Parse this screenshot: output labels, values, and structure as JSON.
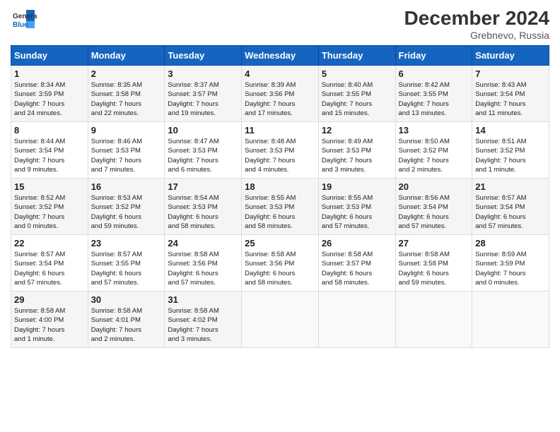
{
  "header": {
    "logo_line1": "General",
    "logo_line2": "Blue",
    "month": "December 2024",
    "location": "Grebnevo, Russia"
  },
  "days_of_week": [
    "Sunday",
    "Monday",
    "Tuesday",
    "Wednesday",
    "Thursday",
    "Friday",
    "Saturday"
  ],
  "weeks": [
    [
      {
        "day": "1",
        "info": "Sunrise: 8:34 AM\nSunset: 3:59 PM\nDaylight: 7 hours\nand 24 minutes."
      },
      {
        "day": "2",
        "info": "Sunrise: 8:35 AM\nSunset: 3:58 PM\nDaylight: 7 hours\nand 22 minutes."
      },
      {
        "day": "3",
        "info": "Sunrise: 8:37 AM\nSunset: 3:57 PM\nDaylight: 7 hours\nand 19 minutes."
      },
      {
        "day": "4",
        "info": "Sunrise: 8:39 AM\nSunset: 3:56 PM\nDaylight: 7 hours\nand 17 minutes."
      },
      {
        "day": "5",
        "info": "Sunrise: 8:40 AM\nSunset: 3:55 PM\nDaylight: 7 hours\nand 15 minutes."
      },
      {
        "day": "6",
        "info": "Sunrise: 8:42 AM\nSunset: 3:55 PM\nDaylight: 7 hours\nand 13 minutes."
      },
      {
        "day": "7",
        "info": "Sunrise: 8:43 AM\nSunset: 3:54 PM\nDaylight: 7 hours\nand 11 minutes."
      }
    ],
    [
      {
        "day": "8",
        "info": "Sunrise: 8:44 AM\nSunset: 3:54 PM\nDaylight: 7 hours\nand 9 minutes."
      },
      {
        "day": "9",
        "info": "Sunrise: 8:46 AM\nSunset: 3:53 PM\nDaylight: 7 hours\nand 7 minutes."
      },
      {
        "day": "10",
        "info": "Sunrise: 8:47 AM\nSunset: 3:53 PM\nDaylight: 7 hours\nand 6 minutes."
      },
      {
        "day": "11",
        "info": "Sunrise: 8:48 AM\nSunset: 3:53 PM\nDaylight: 7 hours\nand 4 minutes."
      },
      {
        "day": "12",
        "info": "Sunrise: 8:49 AM\nSunset: 3:53 PM\nDaylight: 7 hours\nand 3 minutes."
      },
      {
        "day": "13",
        "info": "Sunrise: 8:50 AM\nSunset: 3:52 PM\nDaylight: 7 hours\nand 2 minutes."
      },
      {
        "day": "14",
        "info": "Sunrise: 8:51 AM\nSunset: 3:52 PM\nDaylight: 7 hours\nand 1 minute."
      }
    ],
    [
      {
        "day": "15",
        "info": "Sunrise: 8:52 AM\nSunset: 3:52 PM\nDaylight: 7 hours\nand 0 minutes."
      },
      {
        "day": "16",
        "info": "Sunrise: 8:53 AM\nSunset: 3:52 PM\nDaylight: 6 hours\nand 59 minutes."
      },
      {
        "day": "17",
        "info": "Sunrise: 8:54 AM\nSunset: 3:53 PM\nDaylight: 6 hours\nand 58 minutes."
      },
      {
        "day": "18",
        "info": "Sunrise: 8:55 AM\nSunset: 3:53 PM\nDaylight: 6 hours\nand 58 minutes."
      },
      {
        "day": "19",
        "info": "Sunrise: 8:55 AM\nSunset: 3:53 PM\nDaylight: 6 hours\nand 57 minutes."
      },
      {
        "day": "20",
        "info": "Sunrise: 8:56 AM\nSunset: 3:54 PM\nDaylight: 6 hours\nand 57 minutes."
      },
      {
        "day": "21",
        "info": "Sunrise: 8:57 AM\nSunset: 3:54 PM\nDaylight: 6 hours\nand 57 minutes."
      }
    ],
    [
      {
        "day": "22",
        "info": "Sunrise: 8:57 AM\nSunset: 3:54 PM\nDaylight: 6 hours\nand 57 minutes."
      },
      {
        "day": "23",
        "info": "Sunrise: 8:57 AM\nSunset: 3:55 PM\nDaylight: 6 hours\nand 57 minutes."
      },
      {
        "day": "24",
        "info": "Sunrise: 8:58 AM\nSunset: 3:56 PM\nDaylight: 6 hours\nand 57 minutes."
      },
      {
        "day": "25",
        "info": "Sunrise: 8:58 AM\nSunset: 3:56 PM\nDaylight: 6 hours\nand 58 minutes."
      },
      {
        "day": "26",
        "info": "Sunrise: 8:58 AM\nSunset: 3:57 PM\nDaylight: 6 hours\nand 58 minutes."
      },
      {
        "day": "27",
        "info": "Sunrise: 8:58 AM\nSunset: 3:58 PM\nDaylight: 6 hours\nand 59 minutes."
      },
      {
        "day": "28",
        "info": "Sunrise: 8:59 AM\nSunset: 3:59 PM\nDaylight: 7 hours\nand 0 minutes."
      }
    ],
    [
      {
        "day": "29",
        "info": "Sunrise: 8:58 AM\nSunset: 4:00 PM\nDaylight: 7 hours\nand 1 minute."
      },
      {
        "day": "30",
        "info": "Sunrise: 8:58 AM\nSunset: 4:01 PM\nDaylight: 7 hours\nand 2 minutes."
      },
      {
        "day": "31",
        "info": "Sunrise: 8:58 AM\nSunset: 4:02 PM\nDaylight: 7 hours\nand 3 minutes."
      },
      {
        "day": "",
        "info": ""
      },
      {
        "day": "",
        "info": ""
      },
      {
        "day": "",
        "info": ""
      },
      {
        "day": "",
        "info": ""
      }
    ]
  ]
}
